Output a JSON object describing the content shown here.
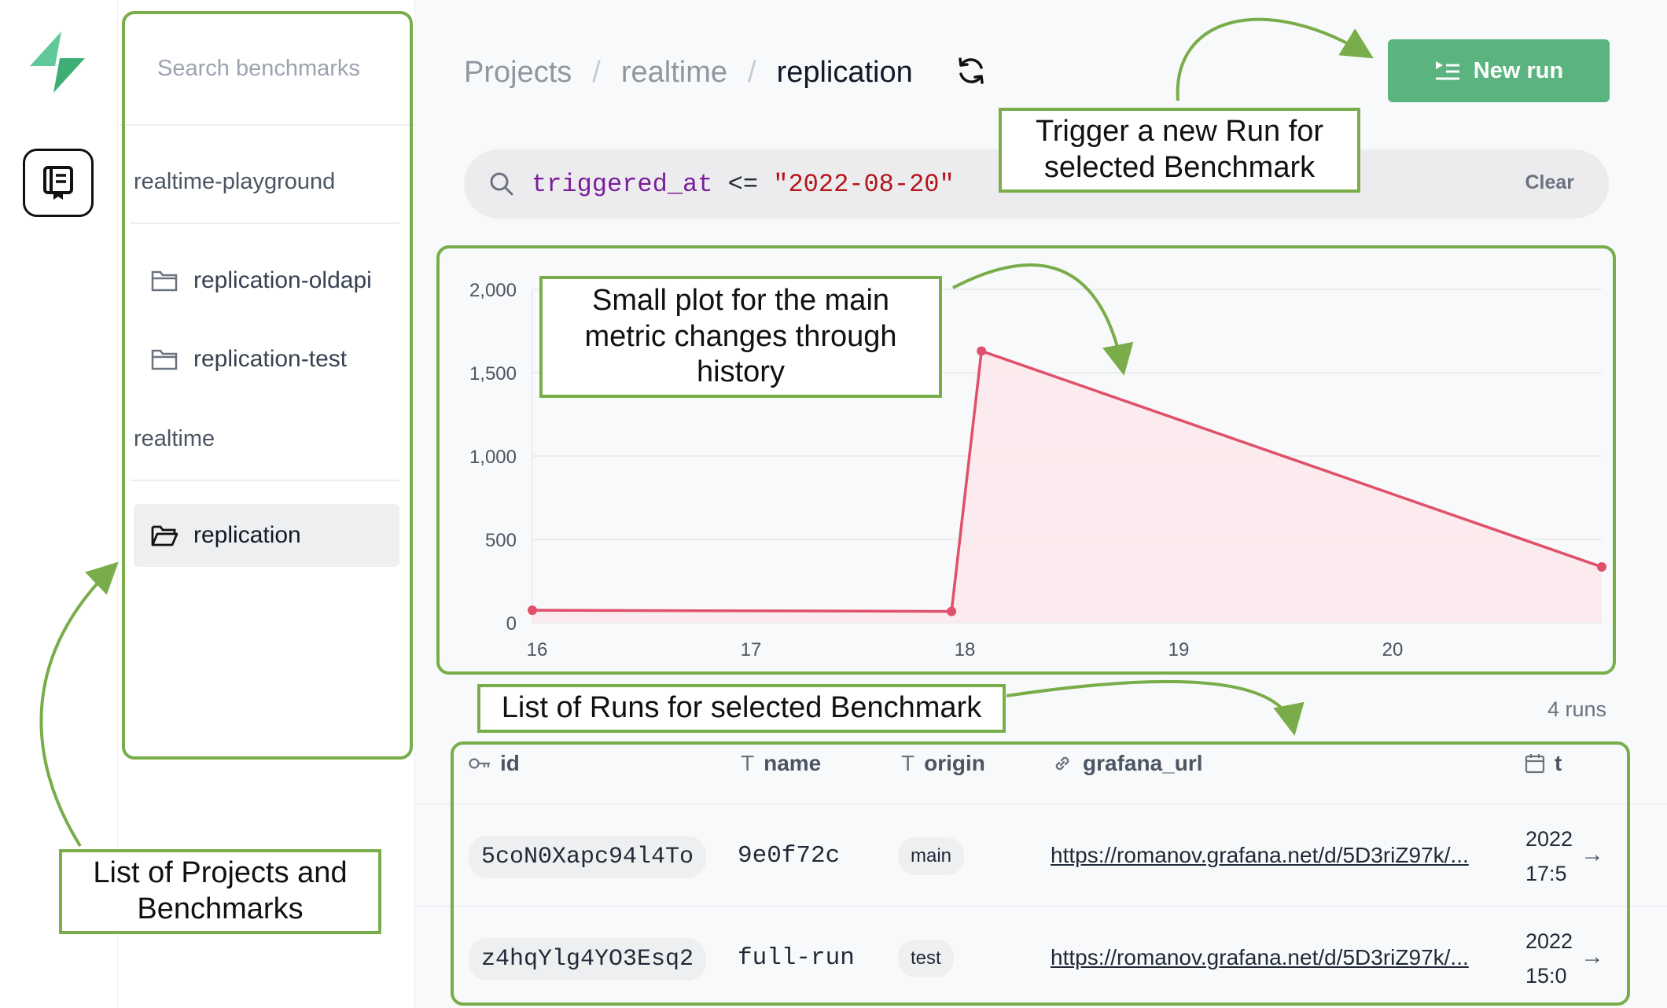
{
  "sidebar": {
    "search_placeholder": "Search benchmarks",
    "groups": [
      {
        "label": "realtime-playground",
        "items": [
          "replication-oldapi",
          "replication-test"
        ]
      },
      {
        "label": "realtime",
        "items": [
          "replication"
        ]
      }
    ],
    "active_item": "replication"
  },
  "breadcrumb": {
    "items": [
      "Projects",
      "realtime"
    ],
    "current": "replication",
    "separator": "/"
  },
  "header": {
    "new_run_label": "New run"
  },
  "filter": {
    "key": "triggered_at",
    "operator": "<=",
    "value": "\"2022-08-20\"",
    "clear_label": "Clear"
  },
  "chart_data": {
    "type": "area",
    "x_tick_labels": [
      "16",
      "17",
      "18",
      "19",
      "20"
    ],
    "y_tick_labels": [
      "0",
      "500",
      "1,000",
      "1,500",
      "2,000"
    ],
    "ylim": [
      0,
      2000
    ],
    "xlim": [
      16,
      21
    ],
    "series": [
      {
        "points": [
          [
            16,
            75
          ],
          [
            17.96,
            68
          ],
          [
            18.1,
            1630
          ],
          [
            21,
            335
          ]
        ]
      }
    ],
    "grid": true,
    "colors": {
      "line": "#e0506a",
      "fill": "#fbe9ec"
    }
  },
  "runs": {
    "count_label": "4 runs",
    "columns": [
      {
        "icon": "key-icon",
        "label": "id"
      },
      {
        "icon": "text-type-icon",
        "label": "name"
      },
      {
        "icon": "text-type-icon",
        "label": "origin"
      },
      {
        "icon": "link-icon",
        "label": "grafana_url"
      },
      {
        "icon": "calendar-icon",
        "label": "t"
      }
    ],
    "rows": [
      {
        "id": "5coN0Xapc94l4To",
        "name": "9e0f72c",
        "origin": "main",
        "grafana_url": "https://romanov.grafana.net/d/5D3riZ97k/...",
        "time_line1": "2022",
        "time_line2": "17:5"
      },
      {
        "id": "z4hqYlg4YO3Esq2",
        "name": "full-run",
        "origin": "test",
        "grafana_url": "https://romanov.grafana.net/d/5D3riZ97k/...",
        "time_line1": "2022",
        "time_line2": "15:0"
      }
    ]
  },
  "annotations": {
    "new_run": [
      "Trigger a new Run for",
      "selected Benchmark"
    ],
    "plot": [
      "Small plot for the main",
      "metric changes through",
      "history"
    ],
    "runs_list": "List of Runs for selected Benchmark",
    "projects": [
      "List of Projects and",
      "Benchmarks"
    ]
  },
  "colors": {
    "accent": "#5bb47f",
    "annotation": "#79ad4a"
  }
}
